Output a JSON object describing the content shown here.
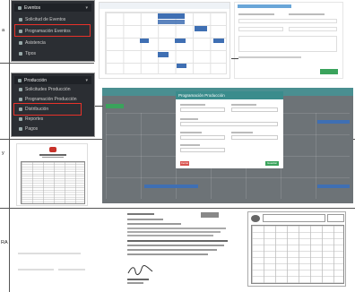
{
  "rows": [
    {
      "label": "a"
    },
    {
      "label": ""
    },
    {
      "label": "y"
    },
    {
      "label": "RA"
    }
  ],
  "menu1": {
    "title": "Eventos",
    "items": [
      "Solicitud de Eventos",
      "Programación Eventos",
      "Asistencia",
      "Tipos"
    ],
    "highlighted_index": 1
  },
  "menu2": {
    "title": "Producción",
    "items": [
      "Solicitudes Producción",
      "Programación Producción",
      "Distribución",
      "Reportes",
      "Pagos"
    ],
    "highlighted_index": 2
  },
  "modal": {
    "title": "Programación Producción",
    "cancel_label": "Cerrar",
    "save_label": "Guardar"
  },
  "colors": {
    "sidebar": "#2b2e33",
    "highlight": "#e8322a",
    "teal_header": "#3a8c8c",
    "accent_blue": "#3f6fb3",
    "green": "#3aa35c"
  }
}
